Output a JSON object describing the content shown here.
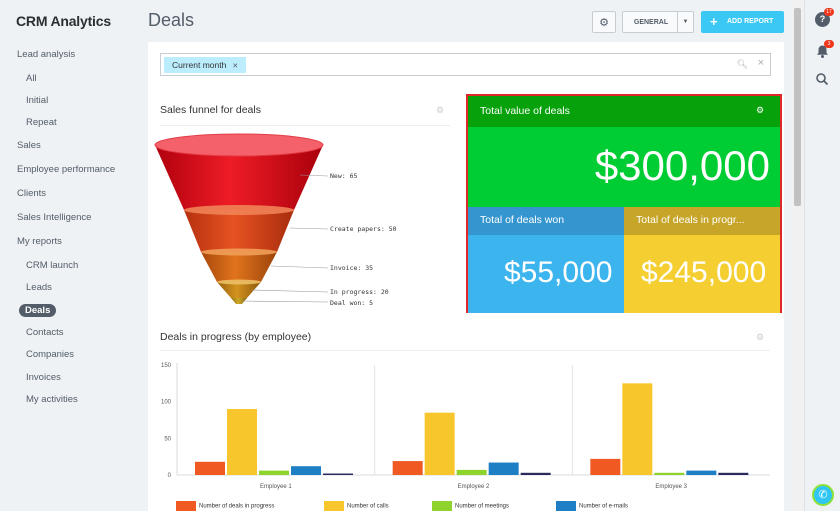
{
  "sidebar": {
    "brand": "CRM Analytics",
    "items": [
      {
        "label": "Lead analysis",
        "level": 0
      },
      {
        "label": "All",
        "level": 1
      },
      {
        "label": "Initial",
        "level": 1
      },
      {
        "label": "Repeat",
        "level": 1
      },
      {
        "label": "Sales",
        "level": 0
      },
      {
        "label": "Employee performance",
        "level": 0
      },
      {
        "label": "Clients",
        "level": 0
      },
      {
        "label": "Sales Intelligence",
        "level": 0
      },
      {
        "label": "My reports",
        "level": 0
      },
      {
        "label": "CRM launch",
        "level": 1
      },
      {
        "label": "Leads",
        "level": 1
      },
      {
        "label": "Deals",
        "level": 1,
        "active": true
      },
      {
        "label": "Contacts",
        "level": 1
      },
      {
        "label": "Companies",
        "level": 1
      },
      {
        "label": "Invoices",
        "level": 1
      },
      {
        "label": "My activities",
        "level": 1
      }
    ]
  },
  "header": {
    "title": "Deals",
    "general_label": "GENERAL",
    "add_report_label": "ADD REPORT"
  },
  "right_panel": {
    "help_badge": "17",
    "notifications_badge": "3"
  },
  "filter": {
    "tag_label": "Current month"
  },
  "funnel_widget": {
    "title": "Sales funnel for deals",
    "stages": [
      {
        "label": "New: 65",
        "value": 65,
        "color": "#e01b22"
      },
      {
        "label": "Create papers: 50",
        "value": 50,
        "color": "#e0451c"
      },
      {
        "label": "Invoice: 35",
        "value": 35,
        "color": "#d96619"
      },
      {
        "label": "In progress: 20",
        "value": 20,
        "color": "#cc8a1a"
      },
      {
        "label": "Deal won: 5",
        "value": 5,
        "color": "#c79e1f"
      }
    ]
  },
  "kpi_widget": {
    "total_label": "Total value of deals",
    "total_value": "$300,000",
    "won_label": "Total of deals won",
    "won_value": "$55,000",
    "progress_label": "Total of deals in progr...",
    "progress_value": "$245,000",
    "colors": {
      "total_header": "#07a10b",
      "total_body": "#00cc33",
      "won_header": "#3595cf",
      "won_body": "#3cb5ef",
      "progress_header": "#c6a529",
      "progress_body": "#f5cf32",
      "highlight_border": "#e02828"
    }
  },
  "bar_widget": {
    "title": "Deals in progress (by employee)"
  },
  "chart_data": {
    "type": "bar",
    "title": "Deals in progress (by employee)",
    "categories": [
      "Employee 1",
      "Employee 2",
      "Employee 3"
    ],
    "ylim": [
      0,
      150
    ],
    "yticks": [
      0,
      50,
      100,
      150
    ],
    "grid": false,
    "legend_position": "bottom",
    "series": [
      {
        "name": "Number of deals in progress",
        "color": "#f05a22",
        "values": [
          18,
          19,
          22
        ]
      },
      {
        "name": "Number of calls",
        "color": "#f7c62c",
        "values": [
          90,
          85,
          125
        ]
      },
      {
        "name": "Number of meetings",
        "color": "#8fd42c",
        "values": [
          6,
          7,
          3
        ]
      },
      {
        "name": "Number of e-mails",
        "color": "#1f7fc5",
        "values": [
          12,
          17,
          6
        ]
      },
      {
        "name": "",
        "color": "#2b2a5e",
        "values": [
          2,
          3,
          3
        ]
      }
    ]
  }
}
